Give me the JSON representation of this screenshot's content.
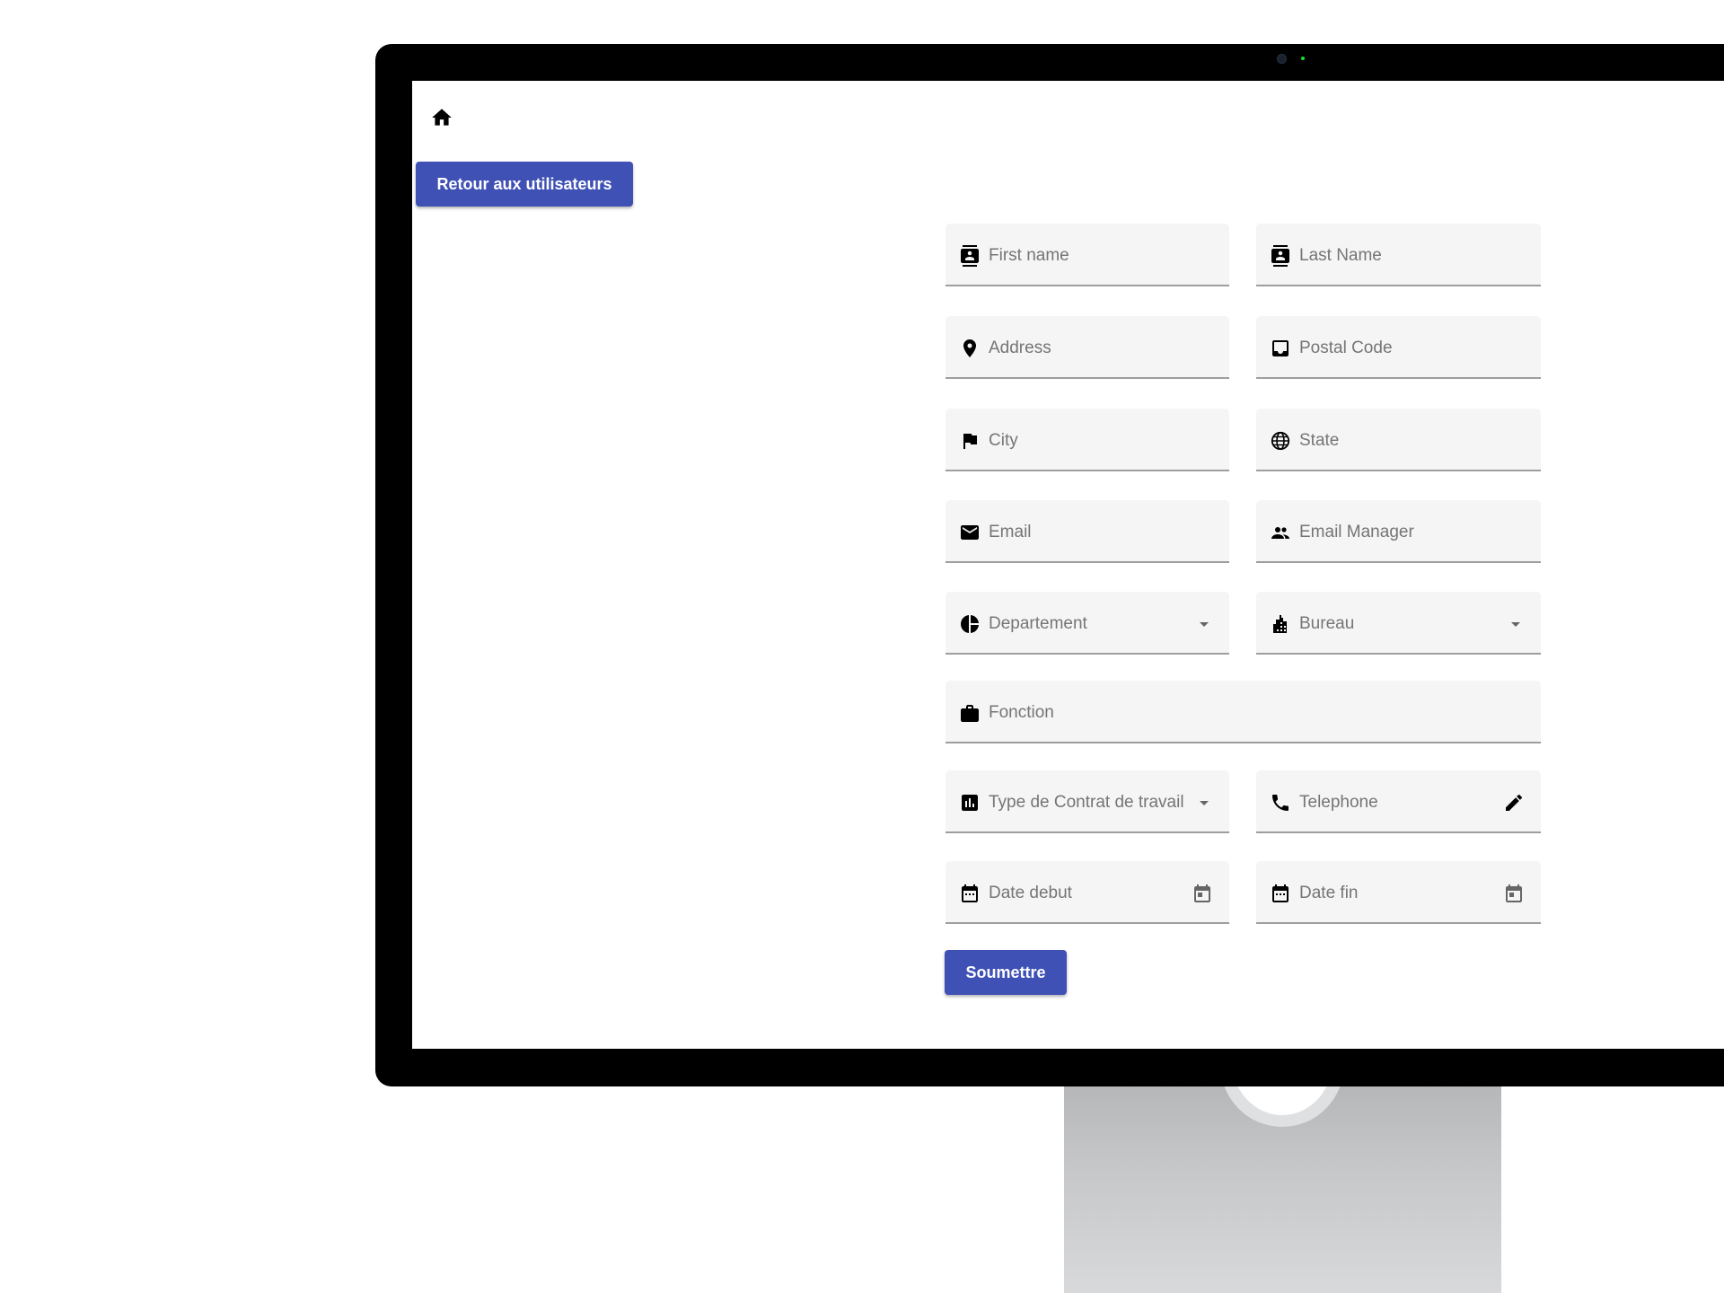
{
  "page": {
    "home_icon": "home-icon",
    "back_button": "Retour aux utilisateurs",
    "submit_button": "Soumettre",
    "accent_color": "#3f51b5"
  },
  "form": {
    "first_name": {
      "label": "First name",
      "icon": "contact-badge-icon",
      "value": ""
    },
    "last_name": {
      "label": "Last Name",
      "icon": "contact-badge-icon",
      "value": ""
    },
    "address": {
      "label": "Address",
      "icon": "location-pin-icon",
      "value": ""
    },
    "postal_code": {
      "label": "Postal Code",
      "icon": "inbox-icon",
      "value": ""
    },
    "city": {
      "label": "City",
      "icon": "flag-icon",
      "value": ""
    },
    "state": {
      "label": "State",
      "icon": "globe-icon",
      "value": ""
    },
    "email": {
      "label": "Email",
      "icon": "mail-icon",
      "value": ""
    },
    "email_manager": {
      "label": "Email Manager",
      "icon": "people-icon",
      "value": ""
    },
    "departement": {
      "label": "Departement",
      "icon": "pie-chart-icon",
      "trailing": "dropdown-arrow-icon",
      "selected": ""
    },
    "bureau": {
      "label": "Bureau",
      "icon": "building-icon",
      "trailing": "dropdown-arrow-icon",
      "selected": ""
    },
    "fonction": {
      "label": "Fonction",
      "icon": "briefcase-icon",
      "value": ""
    },
    "contrat": {
      "label": "Type de Contrat de travail",
      "icon": "bar-chart-icon",
      "trailing": "dropdown-arrow-icon",
      "selected": ""
    },
    "telephone": {
      "label": "Telephone",
      "icon": "phone-icon",
      "trailing": "pencil-icon",
      "value": ""
    },
    "date_debut": {
      "label": "Date debut",
      "icon": "calendar-icon",
      "trailing": "calendar-picker-icon",
      "value": ""
    },
    "date_fin": {
      "label": "Date fin",
      "icon": "calendar-icon",
      "trailing": "calendar-picker-icon",
      "value": ""
    }
  }
}
